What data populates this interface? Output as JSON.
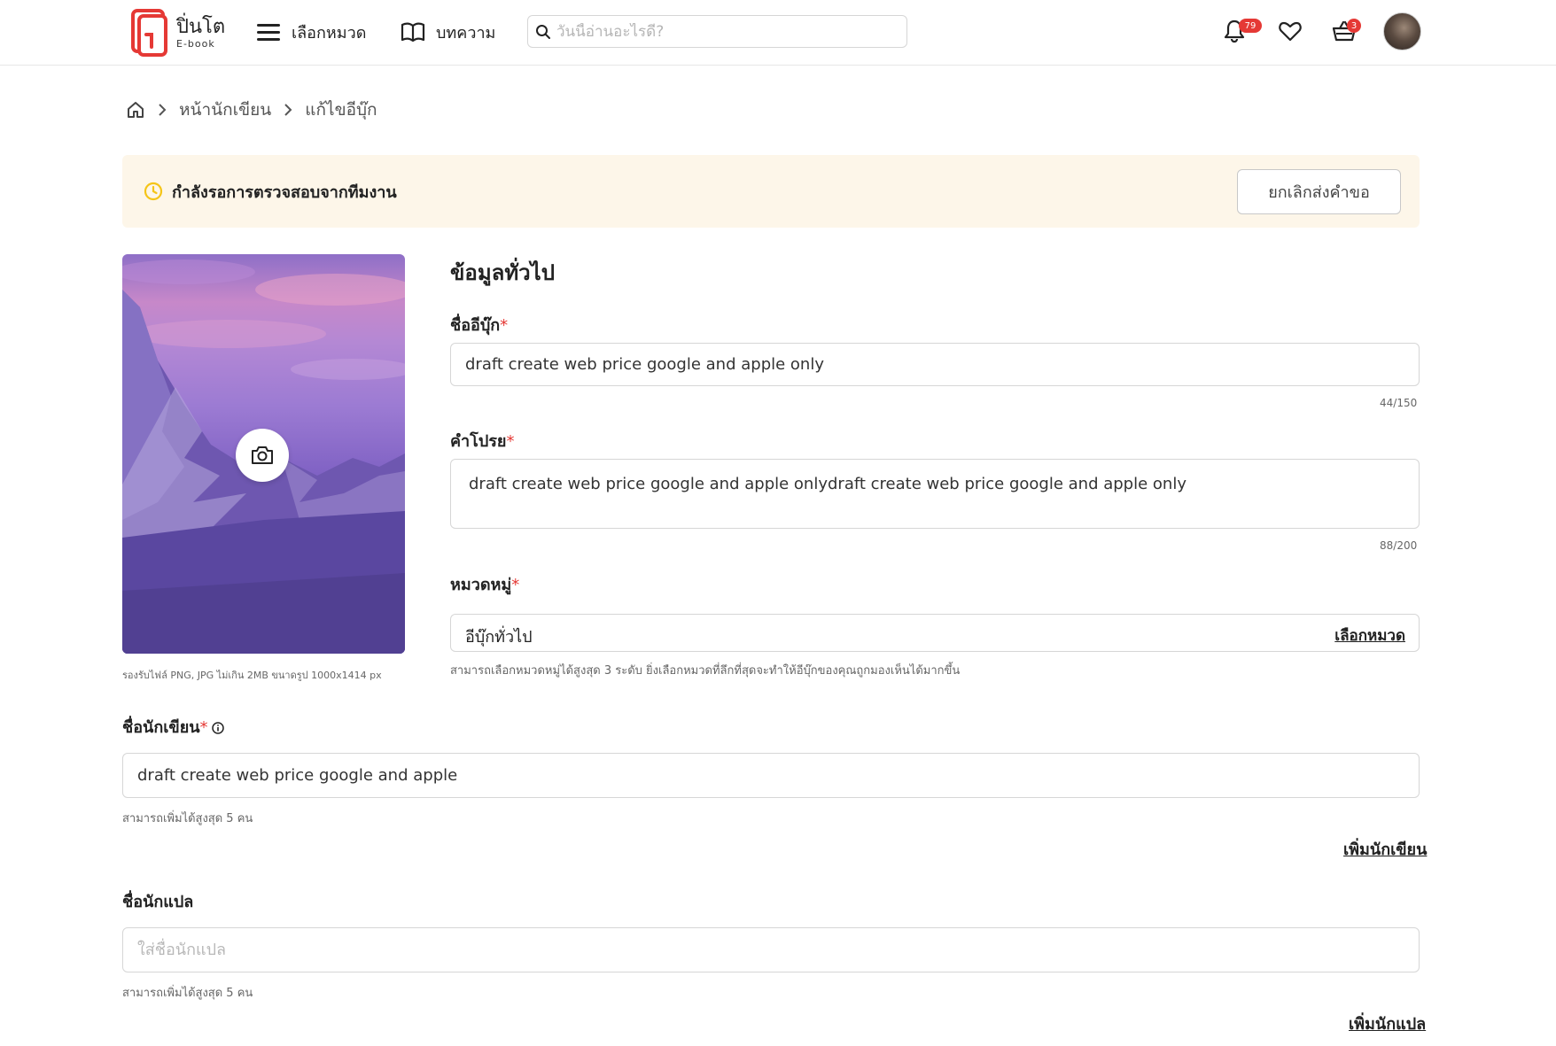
{
  "header": {
    "logo_name": "ปิ่นโต",
    "logo_sub": "E-book",
    "nav_categories": "เลือกหมวด",
    "nav_articles": "บทความ",
    "search_placeholder": "วันนี้อ่านอะไรดี?",
    "notification_count": "79",
    "cart_count": "3"
  },
  "breadcrumb": {
    "items": [
      "หน้านักเขียน",
      "แก้ไขอีบุ๊ก"
    ]
  },
  "banner": {
    "status_text": "กำลังรอการตรวจสอบจากทีมงาน",
    "cancel_button": "ยกเลิกส่งคำขอ"
  },
  "cover": {
    "hint": "รองรับไฟล์ PNG, JPG ไม่เกิน 2MB ขนาดรูป 1000x1414 px"
  },
  "general": {
    "title": "ข้อมูลทั่วไป",
    "name_label": "ชื่ออีบุ๊ก",
    "name_value": "draft create web price google and apple only",
    "name_counter": "44/150",
    "blurb_label": "คำโปรย",
    "blurb_value": "draft create web price google and apple onlydraft create web price google and apple only",
    "blurb_counter": "88/200",
    "category_label": "หมวดหมู่",
    "category_value": "อีบุ๊กทั่วไป",
    "category_link": "เลือกหมวด",
    "category_hint": "สามารถเลือกหมวดหมู่ได้สูงสุด 3 ระดับ ยิ่งเลือกหมวดที่ลึกที่สุดจะทำให้อีบุ๊กของคุณถูกมองเห็นได้มากขึ้น"
  },
  "authors": {
    "label": "ชื่อนักเขียน",
    "value": "draft create web price google and apple",
    "hint": "สามารถเพิ่มได้สูงสุด 5 คน",
    "add_link": "เพิ่มนักเขียน"
  },
  "translators": {
    "label": "ชื่อนักแปล",
    "placeholder": "ใส่ชื่อนักแปล",
    "hint": "สามารถเพิ่มได้สูงสุด 5 คน",
    "add_link": "เพิ่มนักแปล"
  },
  "colors": {
    "brand_red": "#e53935",
    "banner_bg": "#fdf6e9",
    "pending_icon": "#f5c518"
  }
}
